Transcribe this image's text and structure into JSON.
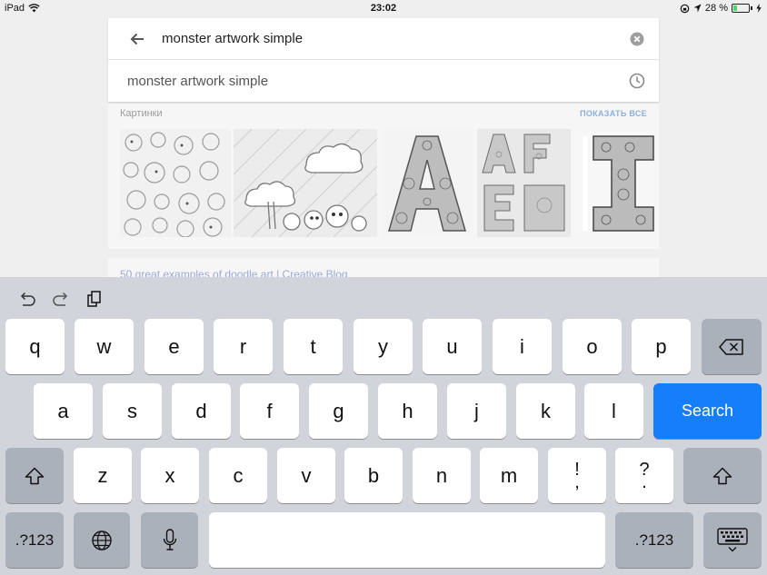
{
  "status_bar": {
    "device": "iPad",
    "time": "23:02",
    "battery_percent_text": "28 %",
    "battery_level": 0.28
  },
  "search": {
    "query": "monster artwork simple",
    "suggestion": "monster artwork simple"
  },
  "images_section": {
    "label": "Картинки",
    "show_all": "ПОКАЗАТЬ ВСЕ"
  },
  "result": {
    "title": "50 great examples of doodle art | Creative Blog"
  },
  "keyboard": {
    "row1": [
      "q",
      "w",
      "e",
      "r",
      "t",
      "y",
      "u",
      "i",
      "o",
      "p"
    ],
    "row2": [
      "a",
      "s",
      "d",
      "f",
      "g",
      "h",
      "j",
      "k",
      "l"
    ],
    "row3": [
      "z",
      "x",
      "c",
      "v",
      "b",
      "n",
      "m"
    ],
    "punct1": [
      "!",
      ","
    ],
    "punct2": [
      "?",
      "."
    ],
    "search_label": "Search",
    "numbers_label_left": ".?123",
    "numbers_label_right": ".?123"
  },
  "colors": {
    "accent": "#147efb",
    "keyboard_bg": "#d1d4db",
    "dark_key": "#abb1bb"
  }
}
